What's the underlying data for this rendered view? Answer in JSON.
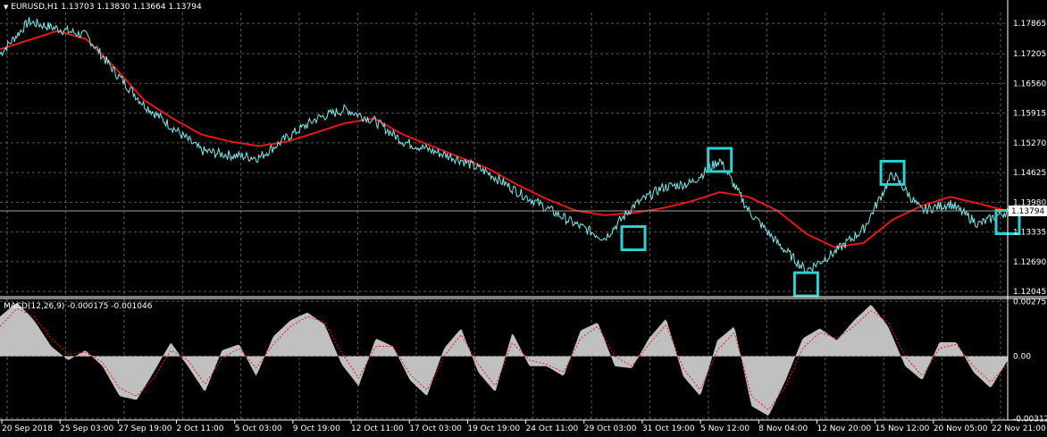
{
  "header": {
    "symbol_line": "EURUSD,H1  1.13703 1.13830 1.13664 1.13794"
  },
  "macd_header": "MACD(12,26,9) -0.000175 -0.001046",
  "colors": {
    "background": "#000000",
    "price": "#7fe9e9",
    "ma": "#e81818",
    "grid": "#5a5a5a",
    "box": "#2ed1d1",
    "histogram": "#c0c0c0",
    "signal": "#e81818",
    "text": "#ffffff"
  },
  "chart_data": [
    {
      "type": "line",
      "title": "EURUSD,H1",
      "series": [
        {
          "role": "price",
          "x": [
            "20 Sep 2018",
            "22 Sep",
            "25 Sep 03:00",
            "26 Sep",
            "27 Sep 19:00",
            "1 Oct",
            "2 Oct 11:00",
            "3 Oct",
            "5 Oct 03:00",
            "8 Oct",
            "9 Oct 19:00",
            "11 Oct",
            "12 Oct 11:00",
            "16 Oct",
            "17 Oct 03:00",
            "18 Oct",
            "19 Oct 19:00",
            "22 Oct",
            "24 Oct 11:00",
            "26 Oct",
            "29 Oct 03:00",
            "30 Oct",
            "31 Oct 19:00",
            "1 Nov",
            "5 Nov 12:00",
            "6 Nov",
            "8 Nov 04:00",
            "9 Nov",
            "12 Nov 20:00",
            "14 Nov",
            "15 Nov 12:00",
            "19 Nov",
            "20 Nov 05:00",
            "21 Nov",
            "22 Nov 21:00",
            "23 Nov"
          ],
          "values": [
            1.172,
            1.179,
            1.1775,
            1.176,
            1.168,
            1.161,
            1.156,
            1.151,
            1.15,
            1.1495,
            1.154,
            1.158,
            1.16,
            1.1575,
            1.153,
            1.151,
            1.149,
            1.146,
            1.142,
            1.1385,
            1.135,
            1.132,
            1.139,
            1.143,
            1.144,
            1.149,
            1.138,
            1.131,
            1.125,
            1.129,
            1.134,
            1.146,
            1.138,
            1.1395,
            1.135,
            1.1379
          ]
        },
        {
          "role": "moving average",
          "x": [
            "20 Sep 2018",
            "22 Sep",
            "25 Sep 03:00",
            "26 Sep",
            "27 Sep 19:00",
            "1 Oct",
            "2 Oct 11:00",
            "3 Oct",
            "5 Oct 03:00",
            "8 Oct",
            "9 Oct 19:00",
            "11 Oct",
            "12 Oct 11:00",
            "16 Oct",
            "17 Oct 03:00",
            "18 Oct",
            "19 Oct 19:00",
            "22 Oct",
            "24 Oct 11:00",
            "26 Oct",
            "29 Oct 03:00",
            "30 Oct",
            "31 Oct 19:00",
            "1 Nov",
            "5 Nov 12:00",
            "6 Nov",
            "8 Nov 04:00",
            "9 Nov",
            "12 Nov 20:00",
            "14 Nov",
            "15 Nov 12:00",
            "19 Nov",
            "20 Nov 05:00",
            "21 Nov",
            "22 Nov 21:00",
            "23 Nov"
          ],
          "values": [
            1.173,
            1.175,
            1.177,
            1.1752,
            1.169,
            1.162,
            1.158,
            1.1545,
            1.153,
            1.152,
            1.153,
            1.155,
            1.157,
            1.158,
            1.1545,
            1.152,
            1.1495,
            1.147,
            1.1435,
            1.1405,
            1.138,
            1.137,
            1.1375,
            1.1385,
            1.14,
            1.142,
            1.141,
            1.138,
            1.133,
            1.13,
            1.131,
            1.136,
            1.139,
            1.141,
            1.1395,
            1.1379
          ]
        }
      ],
      "ylim": [
        1.1195,
        1.181
      ],
      "y_ticks": [
        "1.17865",
        "1.17205",
        "1.16560",
        "1.15915",
        "1.15270",
        "1.14625",
        "1.13980",
        "1.13335",
        "1.12690",
        "1.12045"
      ],
      "current_price_label": "1.13794",
      "highlight_boxes": [
        {
          "x": "31 Oct 19:00",
          "y": 1.132
        },
        {
          "x": "6 Nov",
          "y": 1.149
        },
        {
          "x": "12 Nov 20:00",
          "y": 1.122
        },
        {
          "x": "19 Nov",
          "y": 1.1462
        },
        {
          "x": "23 Nov",
          "y": 1.1355
        }
      ],
      "x_tick_labels": [
        "20 Sep 2018",
        "25 Sep 03:00",
        "27 Sep 19:00",
        "2 Oct 11:00",
        "5 Oct 03:00",
        "9 Oct 19:00",
        "12 Oct 11:00",
        "17 Oct 03:00",
        "19 Oct 19:00",
        "24 Oct 11:00",
        "29 Oct 03:00",
        "31 Oct 19:00",
        "5 Nov 12:00",
        "8 Nov 04:00",
        "12 Nov 20:00",
        "15 Nov 12:00",
        "20 Nov 05:00",
        "22 Nov 21:00"
      ],
      "grid": true
    },
    {
      "type": "area",
      "title": "MACD(12,26,9)",
      "series": [
        {
          "role": "histogram",
          "values": [
            0.002,
            0.0027,
            0.0018,
            0.0005,
            -0.0002,
            0.0003,
            -0.0005,
            -0.002,
            -0.0022,
            -0.0008,
            0.0007,
            -0.0005,
            -0.0018,
            0.0003,
            0.0006,
            -0.001,
            0.001,
            0.0018,
            0.0022,
            0.0016,
            -0.0004,
            -0.0015,
            0.0009,
            0.0005,
            -0.0012,
            -0.002,
            0.0004,
            0.0014,
            -0.0008,
            -0.0018,
            0.0012,
            -0.0005,
            -0.0005,
            -0.001,
            0.0013,
            0.0017,
            -0.0005,
            -0.0006,
            0.0009,
            0.0019,
            -0.001,
            -0.002,
            0.0008,
            0.0015,
            -0.0025,
            -0.003,
            -0.0012,
            0.0009,
            0.0014,
            0.0008,
            0.0018,
            0.0026,
            0.0015,
            -0.0005,
            -0.0012,
            0.0007,
            0.0007,
            -0.0008,
            -0.0016,
            -0.0002
          ]
        },
        {
          "role": "signal",
          "values": [
            0.0015,
            0.0024,
            0.002,
            0.0009,
            0.0001,
            0.0002,
            -0.0003,
            -0.0016,
            -0.002,
            -0.0011,
            0.0003,
            -0.0002,
            -0.0014,
            -0.0001,
            0.0004,
            -0.0006,
            0.0006,
            0.0015,
            0.002,
            0.0017,
            0.0002,
            -0.0011,
            0.0005,
            0.0005,
            -0.0009,
            -0.0017,
            0.0,
            0.0011,
            -0.0004,
            -0.0015,
            0.0007,
            -0.0002,
            -0.0004,
            -0.0008,
            0.0009,
            0.0015,
            0.0,
            -0.0005,
            0.0006,
            0.0016,
            -0.0006,
            -0.0017,
            0.0003,
            0.0012,
            -0.002,
            -0.0027,
            -0.0015,
            0.0004,
            0.0012,
            0.0009,
            0.0015,
            0.0023,
            0.0017,
            0.0,
            -0.001,
            0.0004,
            0.0006,
            -0.0005,
            -0.0013,
            -0.0004
          ]
        }
      ],
      "ylim": [
        -0.0032,
        0.0029
      ],
      "y_ticks": [
        "0.002752",
        "0.00",
        "-0.003124"
      ],
      "grid": true
    }
  ]
}
